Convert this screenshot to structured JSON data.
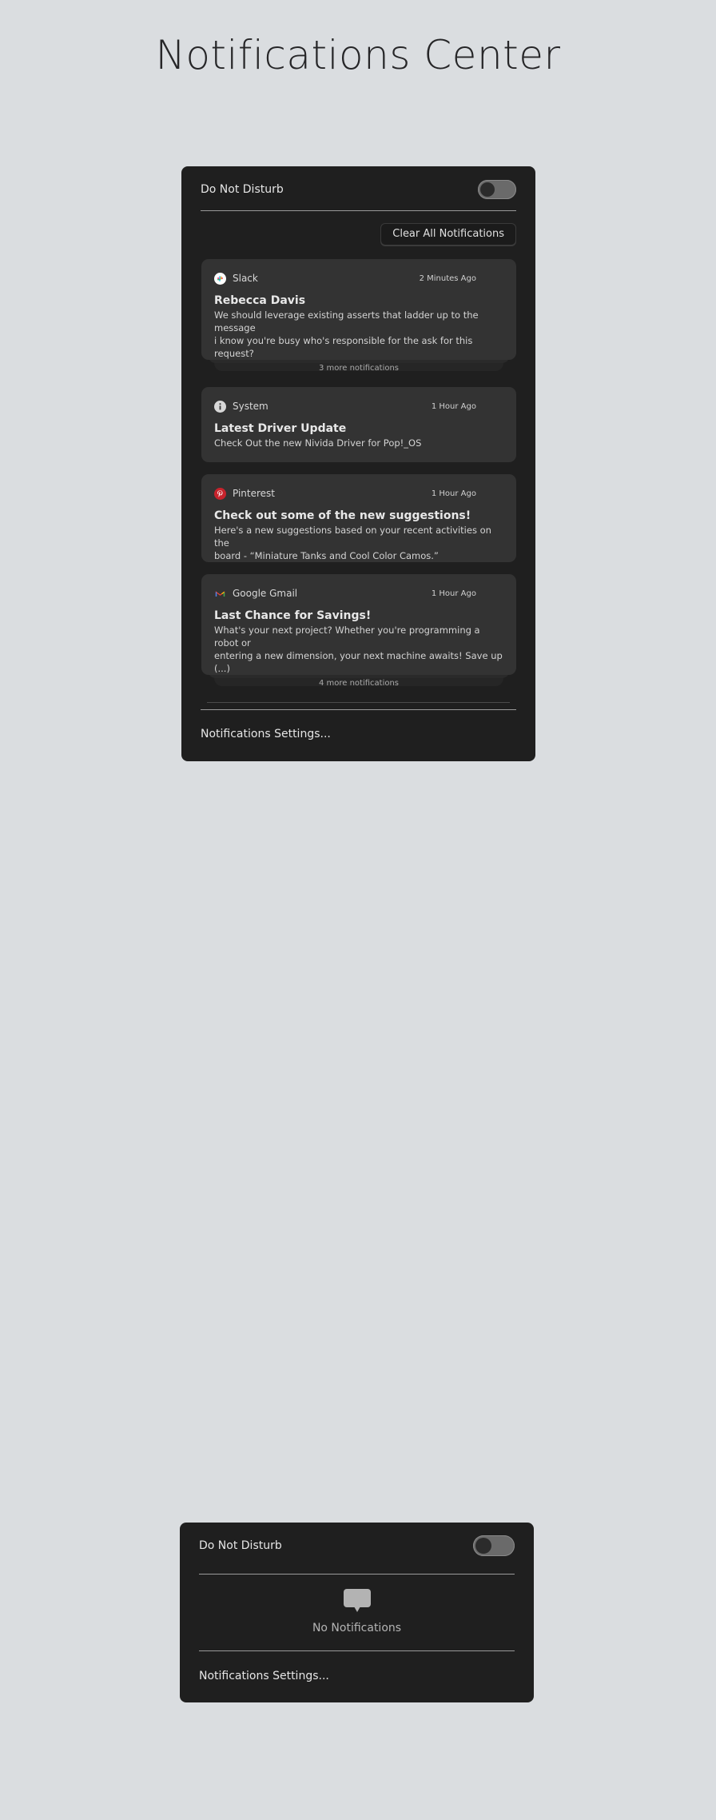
{
  "page": {
    "title": "Notifications Center"
  },
  "main_panel": {
    "dnd_label": "Do Not Disturb",
    "dnd_enabled": false,
    "clear_all_label": "Clear All Notifications",
    "settings_label": "Notifications Settings...",
    "notifications": [
      {
        "app": "Slack",
        "icon": "slack-icon",
        "time": "2 Minutes Ago",
        "title": "Rebecca Davis",
        "body_lines": [
          "We should leverage existing asserts that ladder up to the message",
          "i know you're busy who's responsible for the ask for this request?"
        ],
        "more": "3 more notifications"
      },
      {
        "app": "System",
        "icon": "info-icon",
        "time": "1 Hour Ago",
        "title": "Latest Driver Update",
        "body_lines": [
          "Check Out the new Nivida Driver for Pop!_OS"
        ]
      },
      {
        "app": "Pinterest",
        "icon": "pinterest-icon",
        "time": "1 Hour Ago",
        "title": "Check out some of the new suggestions!",
        "body_lines": [
          "Here's a new suggestions based on your recent activities on the",
          "board - “Miniature Tanks and Cool Color Camos.”"
        ]
      },
      {
        "app": "Google Gmail",
        "icon": "gmail-icon",
        "time": "1 Hour Ago",
        "title": "Last Chance for Savings!",
        "body_lines": [
          "What's your next project? Whether you're programming a robot or",
          "entering a new dimension, your next machine awaits! Save up (...)"
        ],
        "more": "4 more notifications"
      }
    ]
  },
  "empty_panel": {
    "dnd_label": "Do Not Disturb",
    "dnd_enabled": false,
    "empty_label": "No Notifications",
    "empty_icon": "chat-bubble-icon",
    "settings_label": "Notifications Settings..."
  },
  "colors": {
    "page_background": "#dadde0",
    "panel_background": "#1f1f1f",
    "card_background": "#333333",
    "pinterest_red": "#c8232c"
  }
}
